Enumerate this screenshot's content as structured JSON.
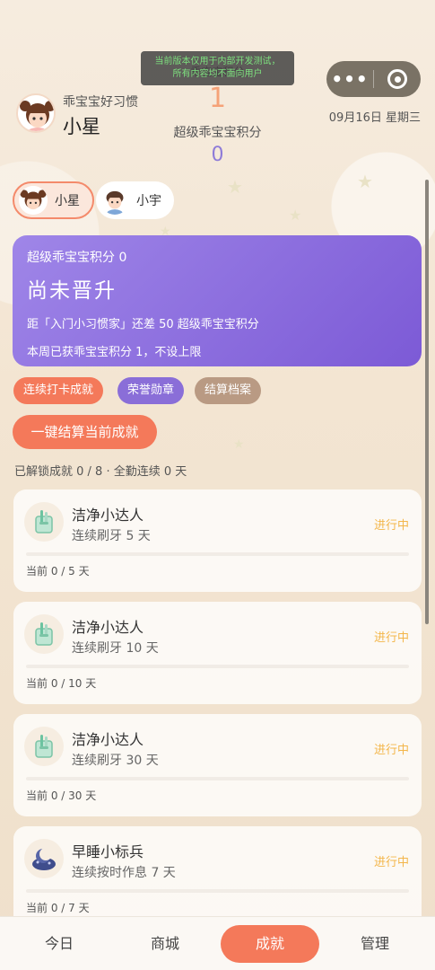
{
  "dev_banner": {
    "line1": "当前版本仅用于内部开发测试，",
    "line2": "所有内容均不面向用户"
  },
  "header": {
    "subtitle": "乖宝宝好习惯",
    "child_name": "小星",
    "score_label_hidden": "乖宝宝积分",
    "score": "1",
    "super_label": "超级乖宝宝积分",
    "super_value": "0",
    "date": "09月16日 星期三"
  },
  "children": [
    {
      "name": "小星",
      "active": true
    },
    {
      "name": "小宇",
      "active": false
    }
  ],
  "rank_card": {
    "line1": "超级乖宝宝积分 0",
    "title": "尚未晋升",
    "line3": "距「入门小习惯家」还差 50 超级乖宝宝积分",
    "line4": "本周已获乖宝宝积分 1，不设上限"
  },
  "pills": [
    "连续打卡成就",
    "荣誉勋章",
    "结算档案"
  ],
  "settle_button": "一键结算当前成就",
  "summary": "已解锁成就 0 / 8 · 全勤连续 0 天",
  "achievements": [
    {
      "icon": "toothbrush-cup-icon",
      "name": "洁净小达人",
      "desc": "连续刷牙 5 天",
      "status": "进行中",
      "progress": "当前 0 / 5 天",
      "ratio": 0
    },
    {
      "icon": "toothbrush-cup-icon",
      "name": "洁净小达人",
      "desc": "连续刷牙 10 天",
      "status": "进行中",
      "progress": "当前 0 / 10 天",
      "ratio": 0
    },
    {
      "icon": "toothbrush-cup-icon",
      "name": "洁净小达人",
      "desc": "连续刷牙 30 天",
      "status": "进行中",
      "progress": "当前 0 / 30 天",
      "ratio": 0
    },
    {
      "icon": "moon-bed-icon",
      "name": "早睡小标兵",
      "desc": "连续按时作息 7 天",
      "status": "进行中",
      "progress": "当前 0 / 7 天",
      "ratio": 0
    }
  ],
  "nav": [
    {
      "label": "今日",
      "active": false
    },
    {
      "label": "商城",
      "active": false
    },
    {
      "label": "成就",
      "active": true
    },
    {
      "label": "管理",
      "active": false
    }
  ],
  "colors": {
    "accent": "#f4795a",
    "purple": "#8a6ed8",
    "status": "#f3b64a"
  }
}
